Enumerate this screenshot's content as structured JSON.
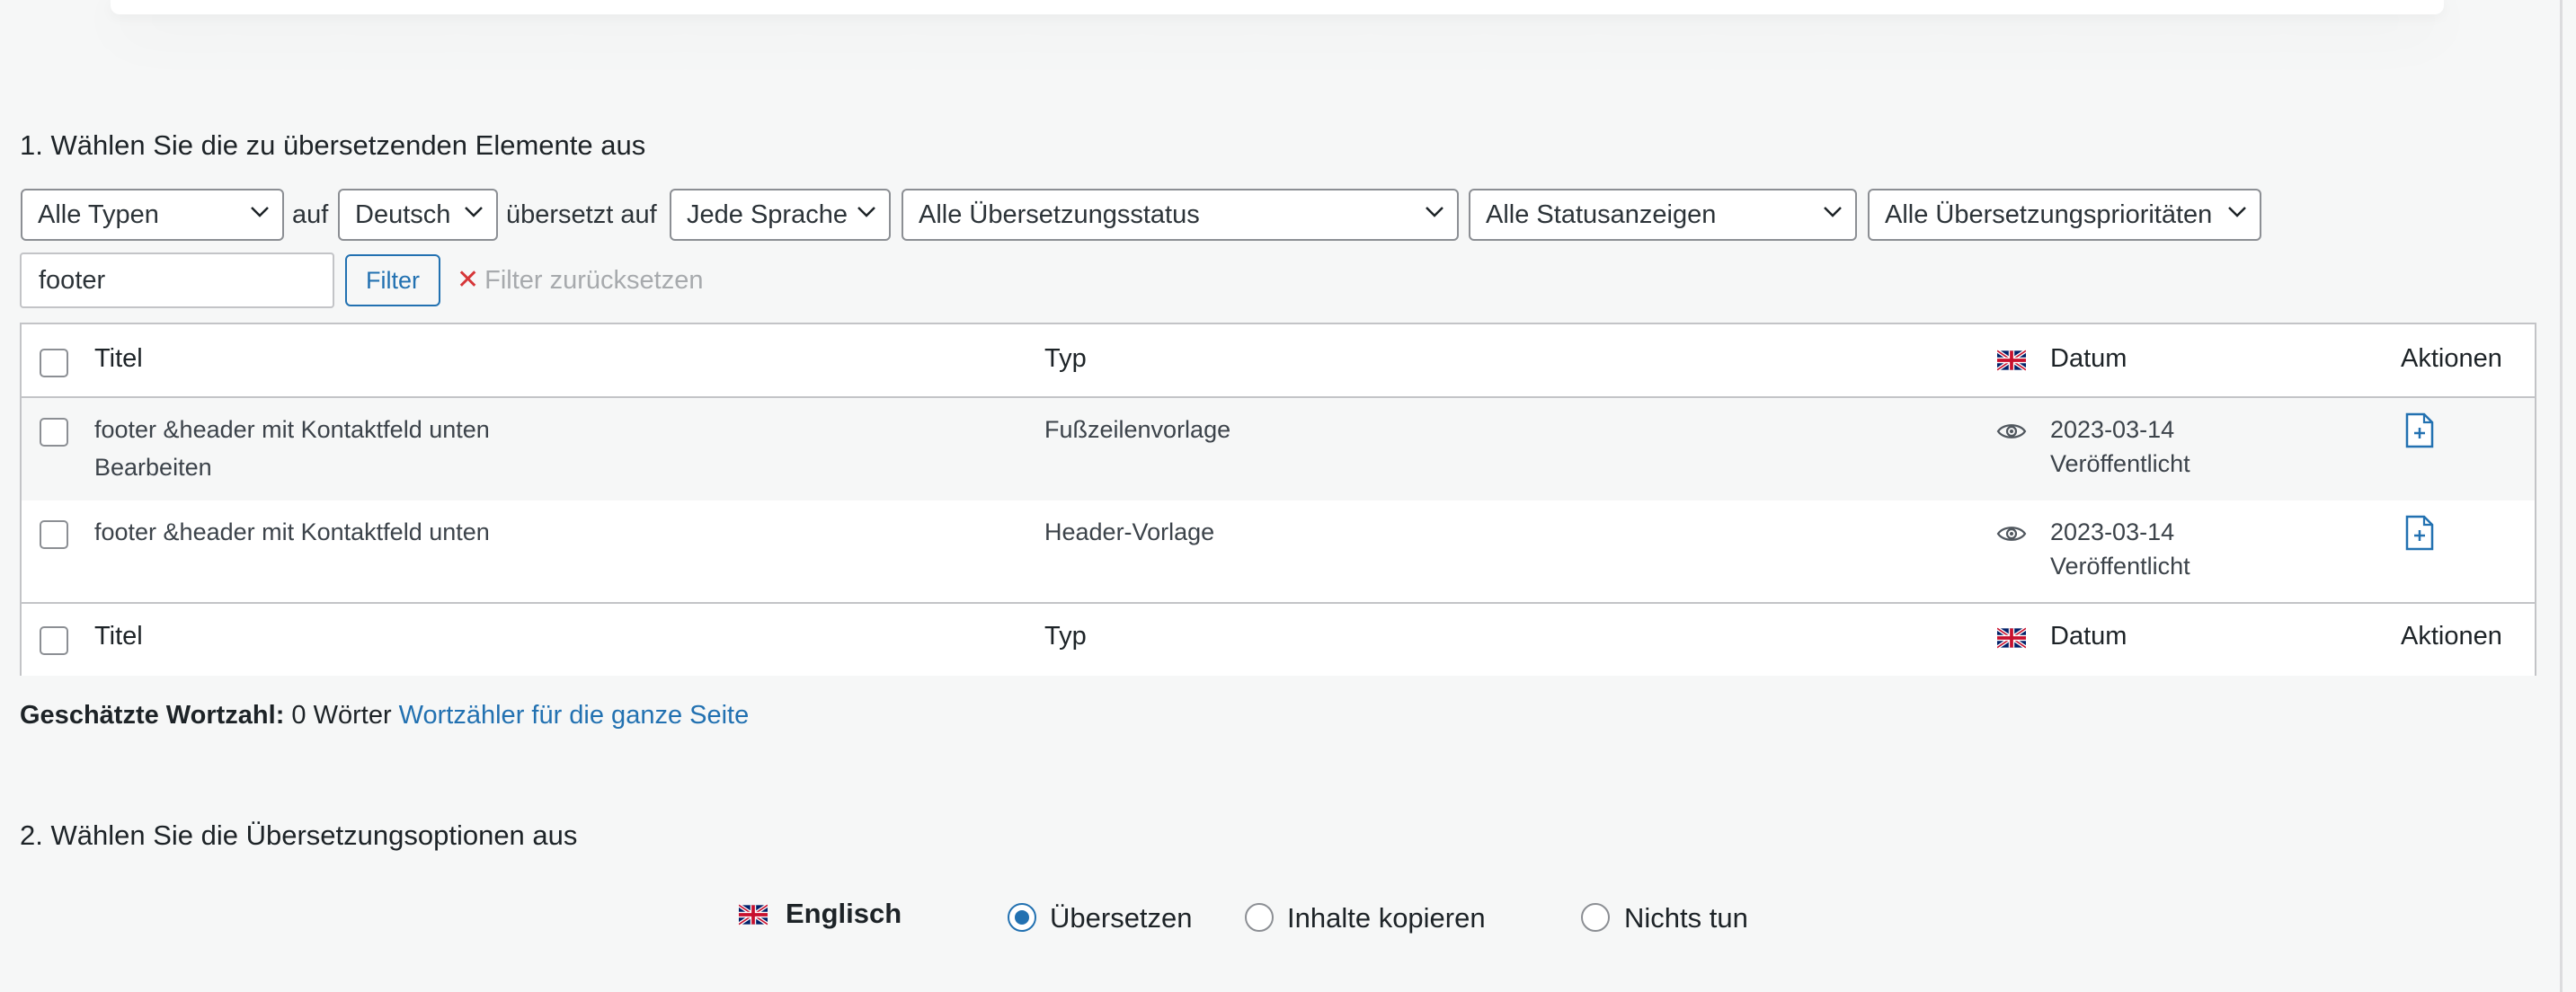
{
  "section1": {
    "heading": "1. Wählen Sie die zu übersetzenden Elemente aus",
    "filters": {
      "type": "Alle Typen",
      "word_from": "auf",
      "language": "Deutsch",
      "word_translated": "übersetzt auf",
      "target_language": "Jede Sprache",
      "translation_status": "Alle Übersetzungsstatus",
      "status_display": "Alle Statusanzeigen",
      "priority": "Alle Übersetzungsprioritäten",
      "search_value": "footer",
      "filter_button": "Filter",
      "reset_label": "Filter zurücksetzen"
    },
    "table": {
      "columns": {
        "title": "Titel",
        "type": "Typ",
        "date": "Datum",
        "actions": "Aktionen"
      },
      "rows": [
        {
          "title": "footer &header mit Kontaktfeld unten",
          "edit": "Bearbeiten",
          "type": "Fußzeilenvorlage",
          "date": "2023-03-14",
          "status": "Veröffentlicht"
        },
        {
          "title": "footer &header mit Kontaktfeld unten",
          "type": "Header-Vorlage",
          "date": "2023-03-14",
          "status": "Veröffentlicht"
        }
      ]
    },
    "wordcount": {
      "label": "Geschätzte Wortzahl:",
      "value": "0 Wörter",
      "link": "Wortzähler für die ganze Seite"
    }
  },
  "section2": {
    "heading": "2. Wählen Sie die Übersetzungsoptionen aus",
    "language": "Englisch",
    "options": [
      "Übersetzen",
      "Inhalte kopieren",
      "Nichts tun"
    ],
    "selected": "Übersetzen"
  },
  "icons": {
    "flag": "uk-flag-icon",
    "preview": "eye-icon",
    "add_translation": "document-plus-icon",
    "dropdown": "chevron-down-icon",
    "reset": "close-icon"
  },
  "colors": {
    "link": "#2271b1",
    "reset_x": "#d63638",
    "row_alt": "#f6f7f7"
  }
}
